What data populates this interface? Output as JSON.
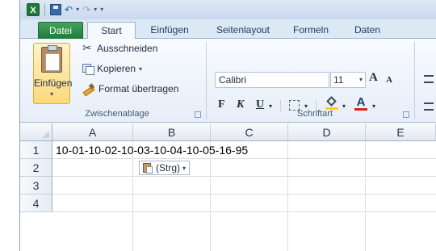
{
  "quick_access": {
    "app_icon_letter": "X",
    "separator": "|",
    "customize_arrow": "▾"
  },
  "tabs": {
    "datei": "Datei",
    "start": "Start",
    "einfuegen": "Einfügen",
    "seitenlayout": "Seitenlayout",
    "formeln": "Formeln",
    "daten": "Daten"
  },
  "clipboard": {
    "paste_label": "Einfügen",
    "cut_label": "Ausschneiden",
    "copy_label": "Kopieren",
    "format_painter_label": "Format übertragen",
    "group_label": "Zwischenablage"
  },
  "font": {
    "font_name": "Calibri",
    "font_size": "11",
    "grow_label": "A",
    "shrink_label": "A",
    "bold_label": "F",
    "italic_label": "K",
    "underline_label": "U",
    "font_color_label": "A",
    "group_label": "Schriftart",
    "fill_color": "#ffd400",
    "font_color": "#e21c1c"
  },
  "sheet": {
    "columns": [
      "A",
      "B",
      "C",
      "D",
      "E"
    ],
    "rows": [
      "1",
      "2",
      "3",
      "4"
    ],
    "cell_a1": "10-01-10-02-10-03-10-04-10-05-16-95",
    "paste_options_label": "(Strg)"
  }
}
